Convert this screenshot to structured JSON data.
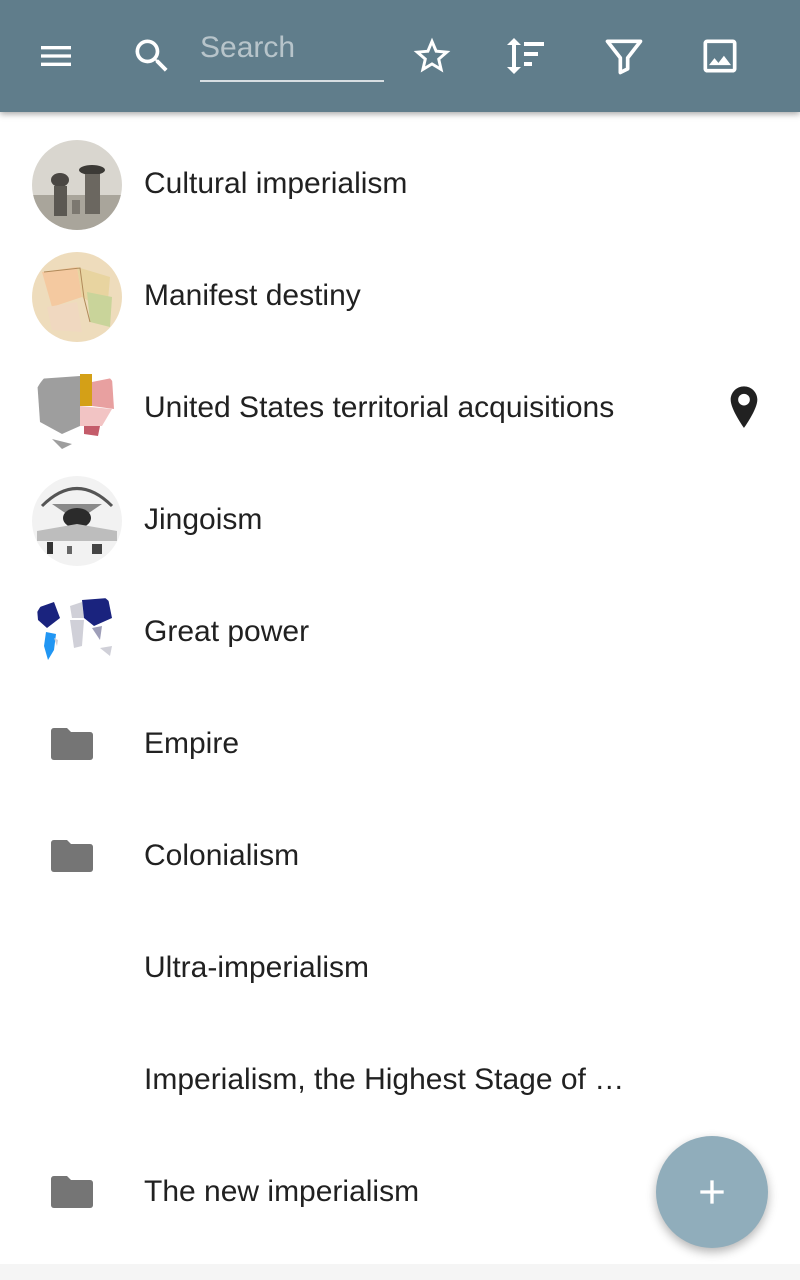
{
  "toolbar": {
    "background": "#607d8b",
    "search_placeholder": "Search",
    "icons": [
      "menu-icon",
      "search-icon",
      "star-icon",
      "sort-icon",
      "filter-icon",
      "image-icon"
    ]
  },
  "items": [
    {
      "label": "Cultural imperialism",
      "icon": "thumbnail"
    },
    {
      "label": "Manifest destiny",
      "icon": "thumbnail"
    },
    {
      "label": "United States territorial acquisitions",
      "icon": "thumbnail",
      "trailing_icon": "location-pin-icon"
    },
    {
      "label": "Jingoism",
      "icon": "thumbnail"
    },
    {
      "label": "Great power",
      "icon": "thumbnail"
    },
    {
      "label": "Empire",
      "icon": "folder-icon"
    },
    {
      "label": "Colonialism",
      "icon": "folder-icon"
    },
    {
      "label": "Ultra-imperialism",
      "icon": "none"
    },
    {
      "label": "Imperialism, the Highest Stage of …",
      "icon": "none"
    },
    {
      "label": "The new imperialism",
      "icon": "folder-icon"
    }
  ],
  "fab": {
    "icon": "plus-icon",
    "color": "#90adbb"
  }
}
